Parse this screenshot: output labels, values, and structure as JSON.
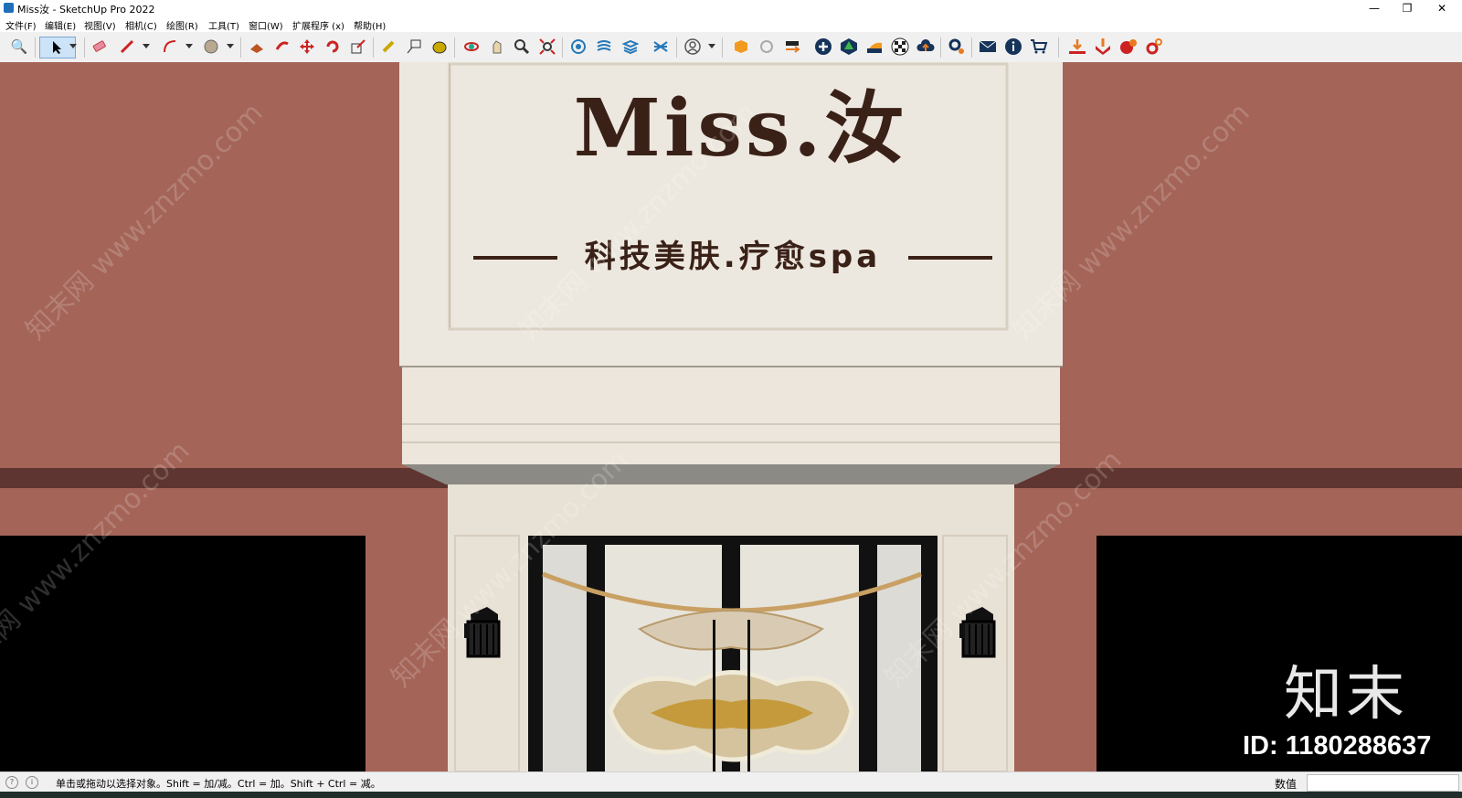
{
  "window": {
    "title": "Miss汝 - SketchUp Pro 2022",
    "minimize": "—",
    "restore": "❐",
    "close": "✕"
  },
  "menu": [
    "文件(F)",
    "编辑(E)",
    "视图(V)",
    "相机(C)",
    "绘图(R)",
    "工具(T)",
    "窗口(W)",
    "扩展程序 (x)",
    "帮助(H)"
  ],
  "toolbar": {
    "icons": [
      "search-icon",
      "select-arrow-icon",
      "eraser-icon",
      "pencil-icon",
      "arc-icon",
      "paint-bucket-icon",
      "push-pull-icon",
      "follow-me-icon",
      "move-icon",
      "rotate-icon",
      "scale-icon",
      "tape-measure-icon",
      "text-label-icon",
      "paint-icon",
      "orbit-icon",
      "pan-icon",
      "zoom-icon",
      "zoom-extents-icon",
      "section-plane-icon",
      "section-display-icon",
      "section-fill-icon",
      "section-cuts-icon",
      "user-profile-icon",
      "extension-warehouse-icon",
      "sync-icon",
      "layout-send-icon",
      "add-icon",
      "tree-icon",
      "style-builder-icon",
      "checker-icon",
      "cloud-upload-icon",
      "settings-icon",
      "mail-icon",
      "info-icon",
      "cart-icon",
      "import-icon",
      "export-icon",
      "plugin-icon",
      "gear-red-icon"
    ]
  },
  "scene": {
    "sign_title": "Miss.汝",
    "sign_subtitle": "科技美肤.疗愈spa",
    "watermark_text": "知末网 www.znzmo.com",
    "watermark_logo": "知末",
    "watermark_id": "ID: 1180288637"
  },
  "status": {
    "hint": "单击或拖动以选择对象。Shift = 加/减。Ctrl = 加。Shift + Ctrl = 减。",
    "measurements_label": "数值",
    "measurements_value": ""
  },
  "colors": {
    "wall": "#a46458",
    "stone": "#ece6dc",
    "sign_text": "#3a2118",
    "frame": "#111111"
  }
}
